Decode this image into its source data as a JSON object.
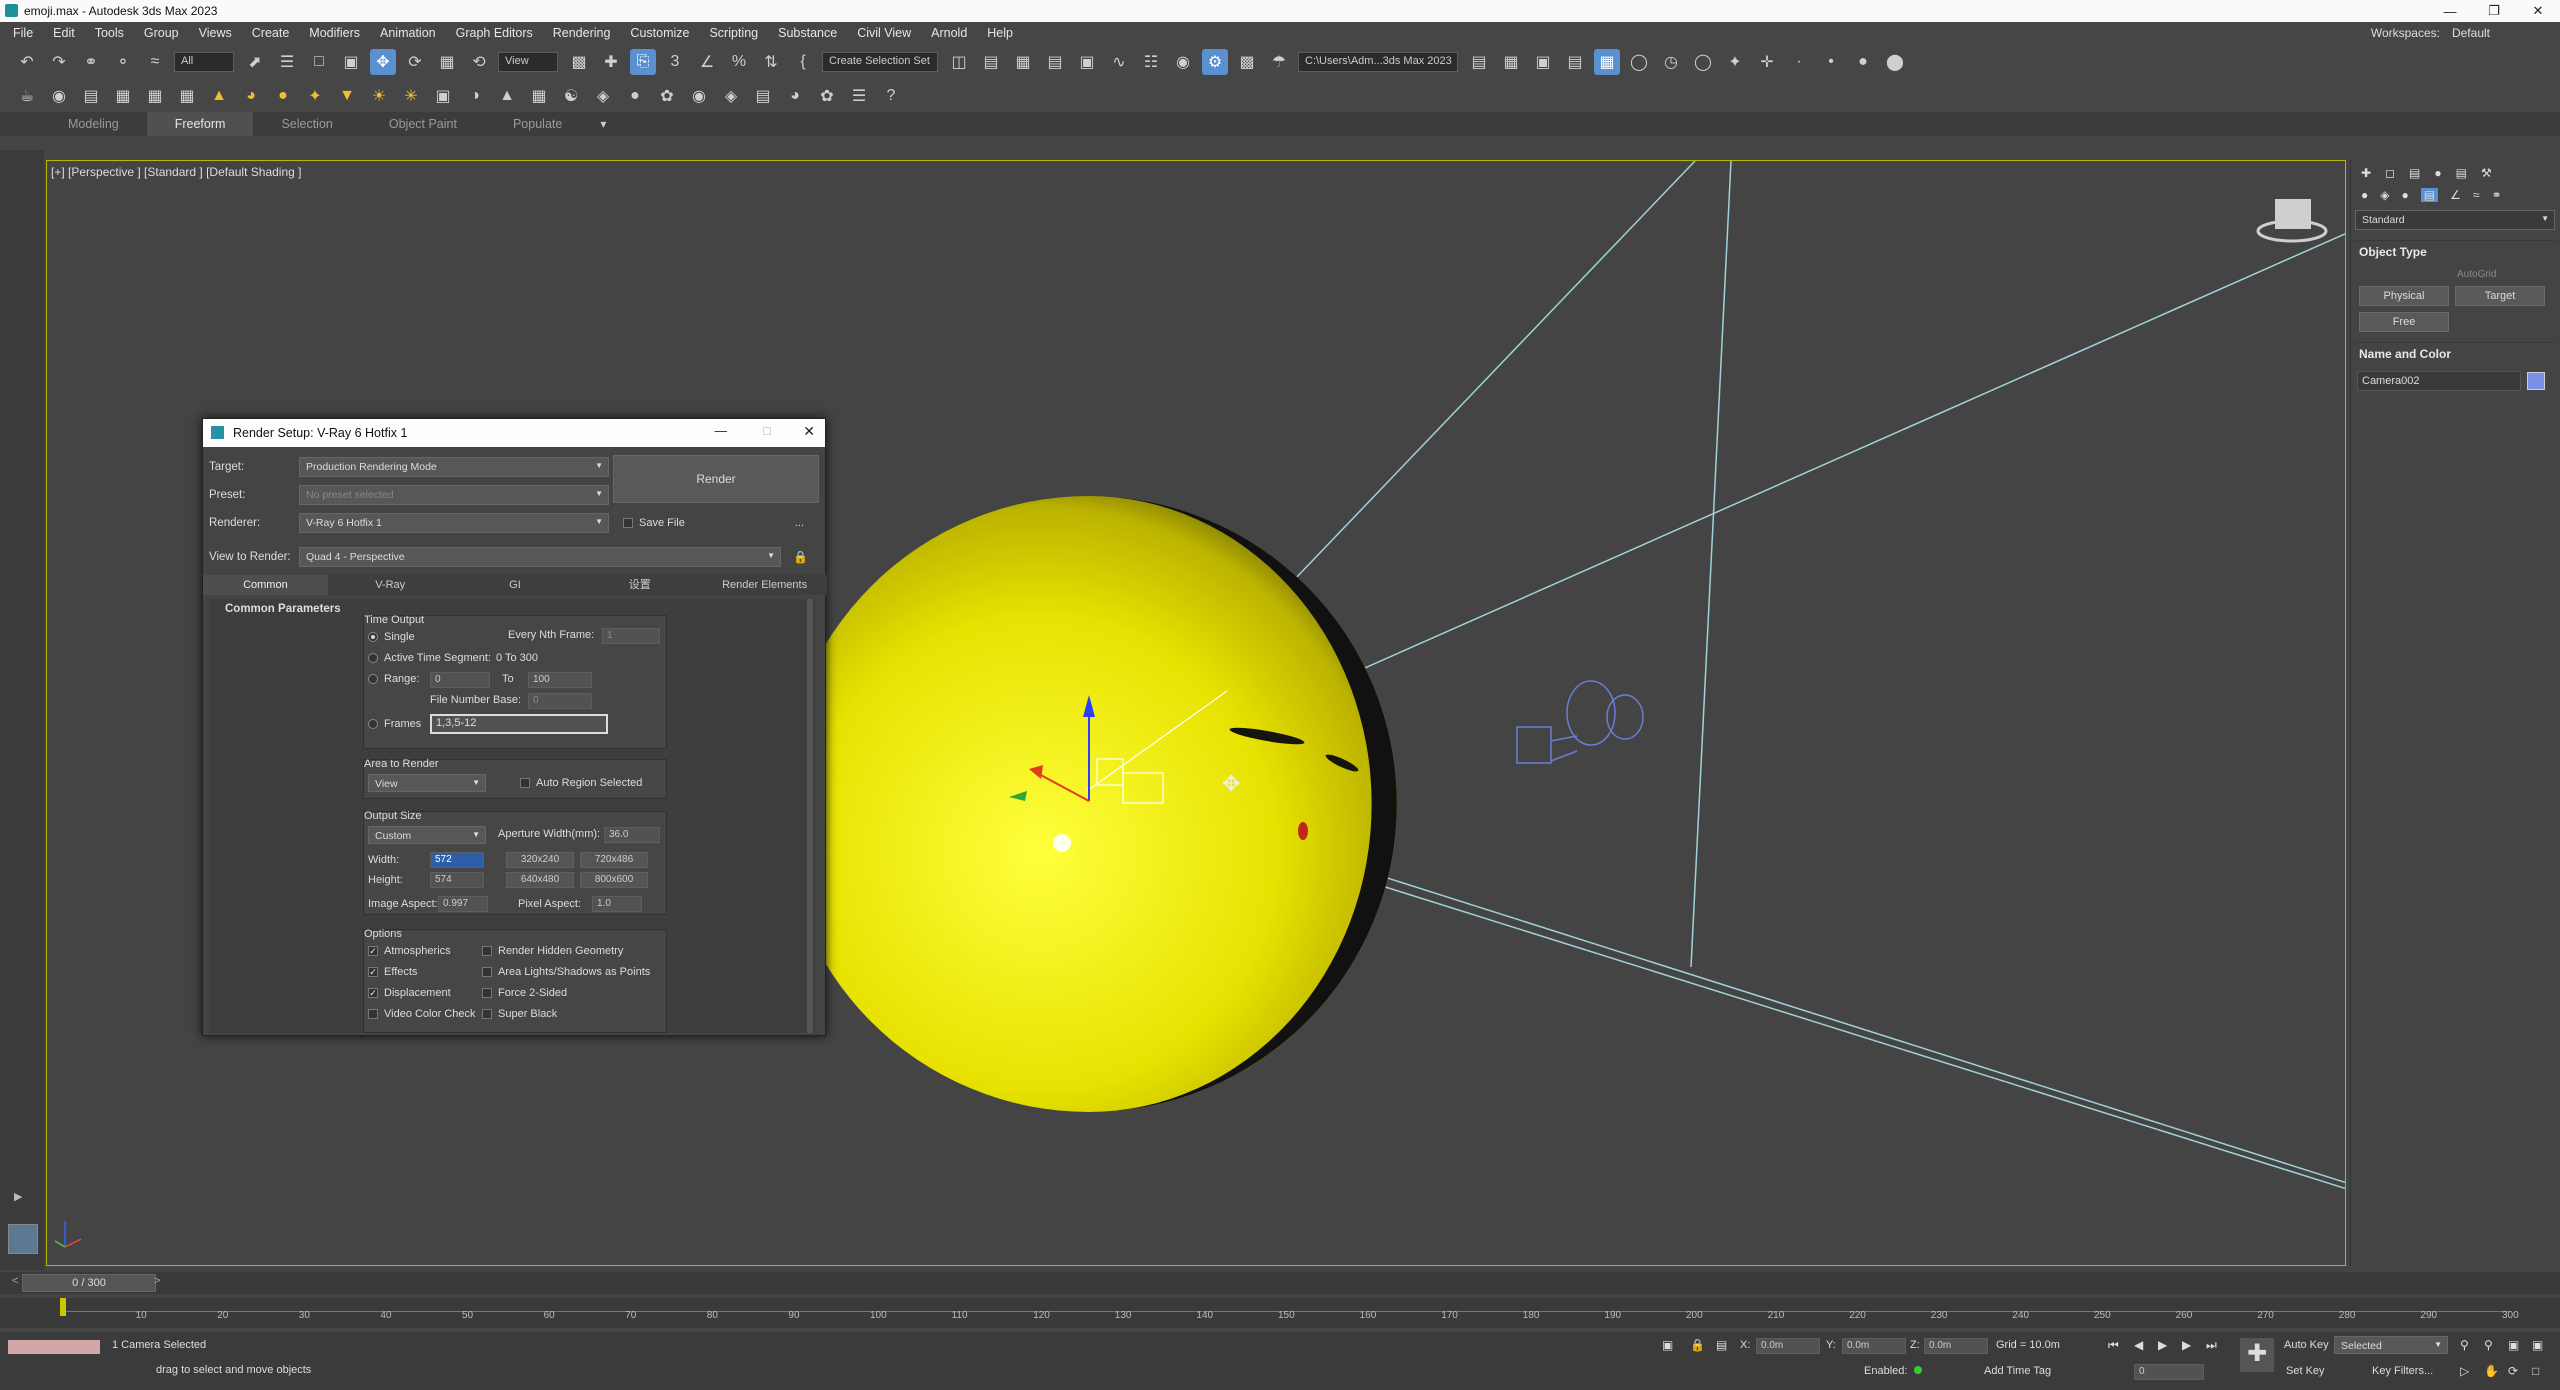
{
  "app": {
    "title": "emoji.max - Autodesk 3ds Max 2023"
  },
  "menu": [
    "File",
    "Edit",
    "Tools",
    "Group",
    "Views",
    "Create",
    "Modifiers",
    "Animation",
    "Graph Editors",
    "Rendering",
    "Customize",
    "Scripting",
    "Substance",
    "Civil View",
    "Arnold",
    "Help"
  ],
  "workspace": {
    "label": "Workspaces:",
    "value": "Default"
  },
  "toolbar": {
    "filter": "All",
    "refcoord": "View",
    "selset": "Create Selection Set",
    "path": "C:\\Users\\Adm...3ds Max 2023"
  },
  "ribbon": {
    "tabs": [
      "Modeling",
      "Freeform",
      "Selection",
      "Object Paint",
      "Populate"
    ],
    "active": "Freeform"
  },
  "viewport": {
    "label": "[+] [Perspective ] [Standard ] [Default Shading ]"
  },
  "cmdpanel": {
    "category": "Standard",
    "object_type": "Object Type",
    "autogrid": "AutoGrid",
    "btn_physical": "Physical",
    "btn_target": "Target",
    "btn_free": "Free",
    "name_color": "Name and Color",
    "object_name": "Camera002"
  },
  "dialog": {
    "title": "Render Setup: V-Ray 6 Hotfix 1",
    "target_label": "Target:",
    "target": "Production Rendering Mode",
    "preset_label": "Preset:",
    "preset": "No preset selected",
    "renderer_label": "Renderer:",
    "renderer": "V-Ray 6 Hotfix 1",
    "savefile": "Save File",
    "dots": "...",
    "view_label": "View to Render:",
    "view": "Quad 4 - Perspective",
    "render_btn": "Render",
    "tabs": [
      "Common",
      "V-Ray",
      "GI",
      "设置",
      "Render Elements"
    ],
    "section": "Common Parameters",
    "time_output": "Time Output",
    "single": "Single",
    "every_nth": "Every Nth Frame:",
    "nth_val": "1",
    "active_seg": "Active Time Segment:",
    "active_val": "0 To 300",
    "range": "Range:",
    "range_from": "0",
    "to": "To",
    "range_to": "100",
    "file_base": "File Number Base:",
    "file_base_val": "0",
    "frames": "Frames",
    "frames_val": "1,3,5-12",
    "area": "Area to Render",
    "area_val": "View",
    "auto_region": "Auto Region Selected",
    "output_size": "Output Size",
    "size_mode": "Custom",
    "aperture": "Aperture Width(mm):",
    "aperture_val": "36.0",
    "width_label": "Width:",
    "width_val": "572",
    "height_label": "Height:",
    "height_val": "574",
    "p1": "320x240",
    "p2": "720x486",
    "p3": "640x480",
    "p4": "800x600",
    "aspect_label": "Image Aspect:",
    "aspect_val": "0.997",
    "pixel_label": "Pixel Aspect:",
    "pixel_val": "1.0",
    "options": "Options",
    "o_atmo": "Atmospherics",
    "o_effects": "Effects",
    "o_disp": "Displacement",
    "o_vcc": "Video Color Check",
    "o_rhg": "Render Hidden Geometry",
    "o_area": "Area Lights/Shadows as Points",
    "o_force": "Force 2-Sided",
    "o_super": "Super Black"
  },
  "timeline": {
    "frame": "0 / 300",
    "ticks": [
      "10",
      "20",
      "30",
      "40",
      "50",
      "60",
      "70",
      "80",
      "90",
      "100",
      "110",
      "120",
      "130",
      "140",
      "150",
      "160",
      "170",
      "180",
      "190",
      "200",
      "210",
      "220",
      "230",
      "240",
      "250",
      "260",
      "270",
      "280",
      "290",
      "300"
    ]
  },
  "status": {
    "selected": "1 Camera Selected",
    "prompt": "drag to select and move objects",
    "x": "0.0m",
    "y": "0.0m",
    "z": "0.0m",
    "grid": "Grid = 10.0m",
    "enabled": "Enabled:",
    "addtag": "Add Time Tag",
    "autokey": "Auto Key",
    "selmode": "Selected",
    "setkey": "Set Key",
    "keyfilters": "Key Filters...",
    "spin": "0"
  }
}
